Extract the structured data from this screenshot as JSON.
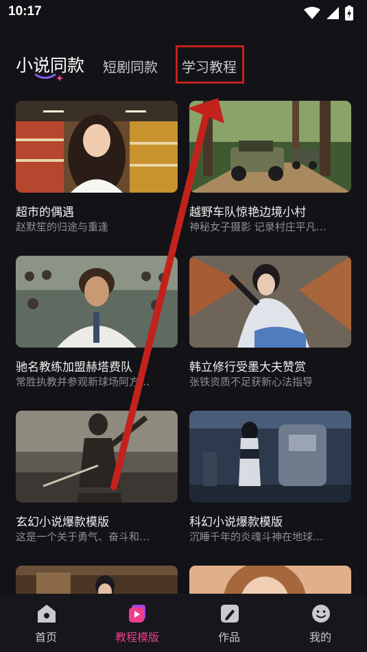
{
  "status": {
    "time": "10:17"
  },
  "tabs": [
    {
      "label": "小说同款",
      "active": true
    },
    {
      "label": "短剧同款",
      "active": false
    },
    {
      "label": "学习教程",
      "active": false
    }
  ],
  "cards": [
    {
      "title": "超市的偶遇",
      "subtitle": "赵默笙的归途与重逢"
    },
    {
      "title": "越野车队惊艳边境小村",
      "subtitle": "神秘女子摄影 记录村庄平凡…"
    },
    {
      "title": "驰名教练加盟赫塔费队",
      "subtitle": "常胜执教并参观新球场阿方…"
    },
    {
      "title": "韩立修行受墨大夫赞赏",
      "subtitle": "张铁资质不足获新心法指导"
    },
    {
      "title": "玄幻小说爆款模版",
      "subtitle": "这是一个关于勇气、奋斗和…"
    },
    {
      "title": "科幻小说爆款模版",
      "subtitle": "沉睡千年的炎魂斗神在地球…"
    }
  ],
  "bottom_nav": [
    {
      "label": "首页",
      "icon": "home-icon",
      "active": false
    },
    {
      "label": "教程模版",
      "icon": "template-icon",
      "active": true
    },
    {
      "label": "作品",
      "icon": "works-icon",
      "active": false
    },
    {
      "label": "我的",
      "icon": "profile-icon",
      "active": false
    }
  ],
  "colors": {
    "accent": "#ef3f8c",
    "highlight_box": "#c3221c",
    "background": "#121217"
  }
}
